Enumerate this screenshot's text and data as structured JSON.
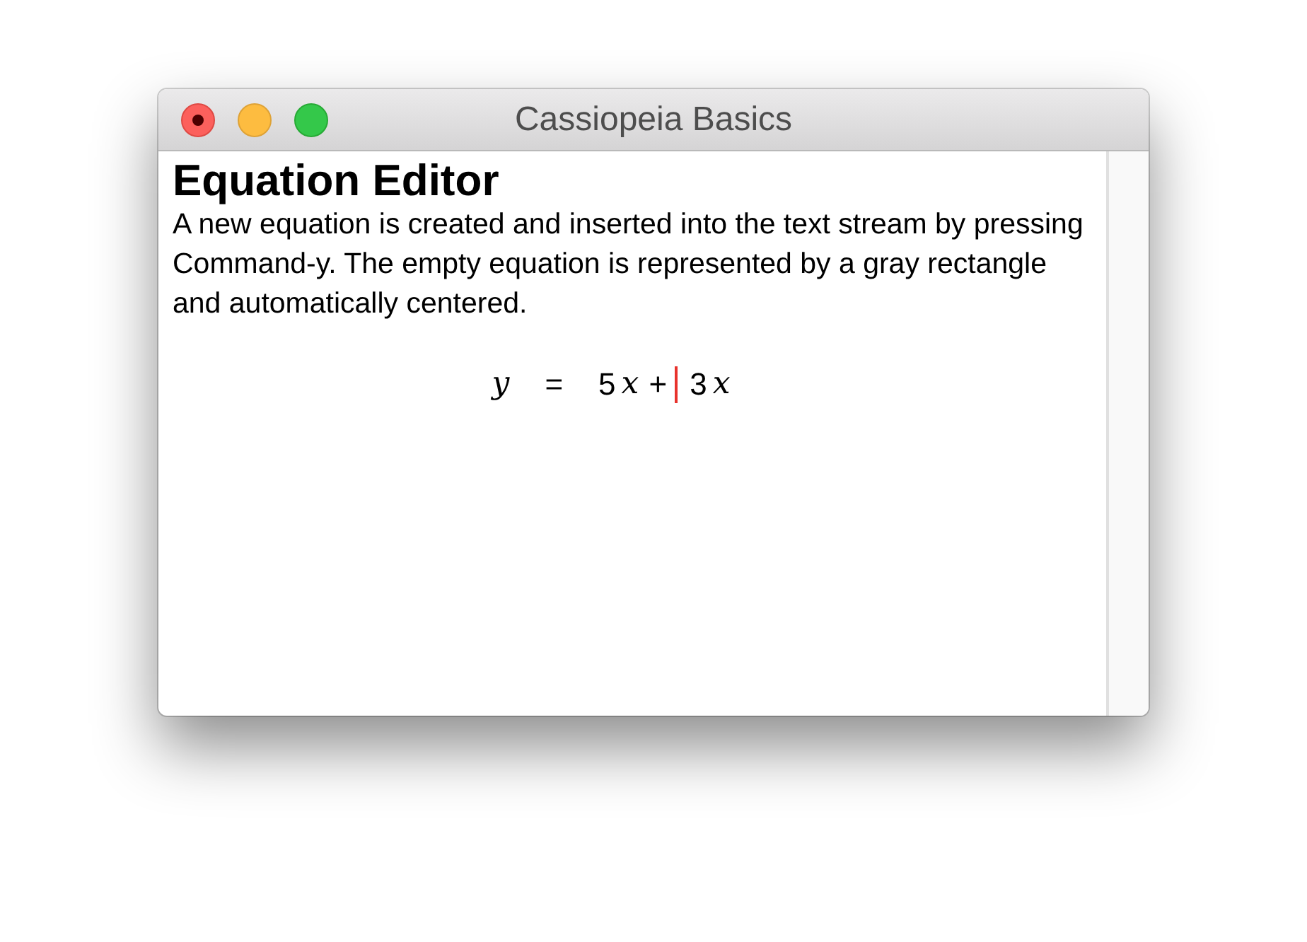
{
  "window": {
    "title": "Cassiopeia Basics",
    "edited": true
  },
  "heading": "Equation Editor",
  "paragraph": "A new equation is created and inserted into the text stream by pressing Command-y. The empty equation is represented by a gray rectangle and automatically centered.",
  "equation": [
    {
      "text": "y",
      "kind": "variable",
      "cursor_after": false
    },
    {
      "text": "=",
      "kind": "relation",
      "cursor_after": false
    },
    {
      "text": "5",
      "kind": "number",
      "cursor_after": false
    },
    {
      "text": "x",
      "kind": "variable",
      "cursor_after": false
    },
    {
      "text": "+",
      "kind": "operator",
      "cursor_after": true
    },
    {
      "text": "3",
      "kind": "number",
      "cursor_after": false
    },
    {
      "text": "x",
      "kind": "variable",
      "cursor_after": false
    }
  ]
}
